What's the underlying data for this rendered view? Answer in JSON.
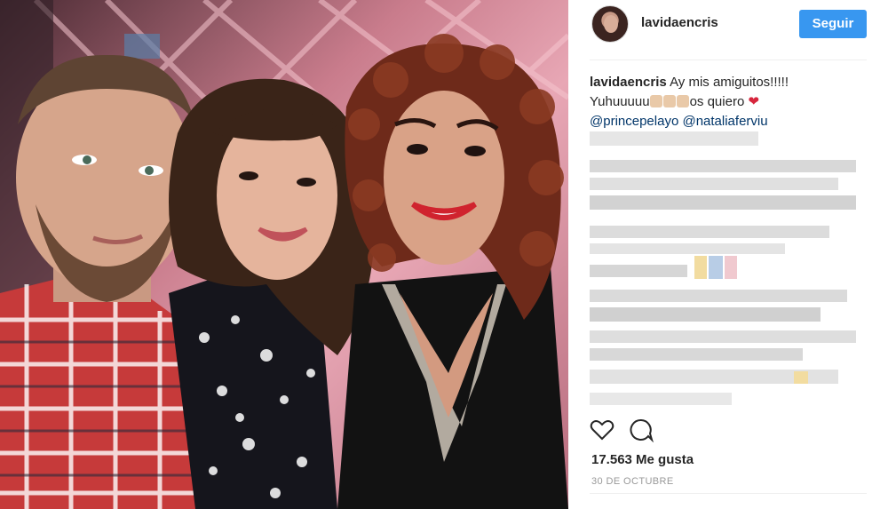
{
  "post": {
    "username": "lavidaencris",
    "follow_label": "Seguir",
    "caption": {
      "username": "lavidaencris",
      "line1": "Ay mis amiguitos!!!!!",
      "line2_prefix": "Yuhuuuuu",
      "line2_suffix": "os quiero",
      "heart": "❤",
      "mention1": "@princepelayo",
      "mention2": "@nataliaferviu"
    },
    "likes": "17.563 Me gusta",
    "date": "30 DE OCTUBRE"
  },
  "icons": {
    "like": "heart-outline-icon",
    "comment": "comment-bubble-icon"
  },
  "colors": {
    "follow_button": "#3897f0",
    "mention": "#003569",
    "heart": "#d7263d"
  }
}
